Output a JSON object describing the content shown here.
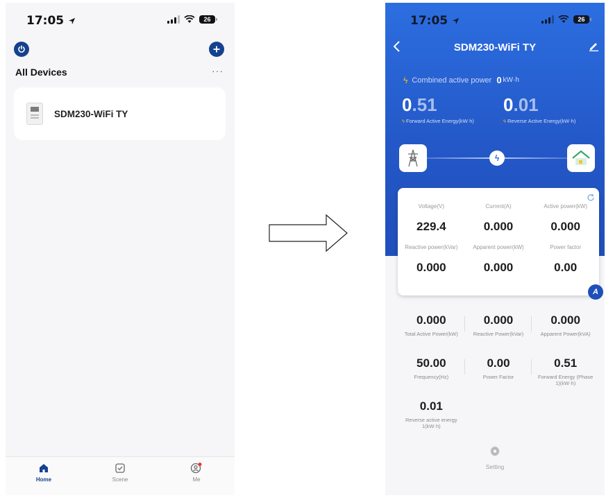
{
  "left_screen": {
    "status": {
      "time": "17:05",
      "battery": "26"
    },
    "section_title": "All Devices",
    "more_label": "···",
    "devices": [
      {
        "name": "SDM230-WiFi TY"
      }
    ],
    "tabs": [
      {
        "label": "Home",
        "icon": "home-icon",
        "active": true
      },
      {
        "label": "Scene",
        "icon": "scene-icon",
        "active": false
      },
      {
        "label": "Me",
        "icon": "profile-icon",
        "active": false
      }
    ],
    "colors": {
      "accent": "#15428e",
      "background": "#f6f6f8",
      "notification": "#e53935"
    }
  },
  "right_screen": {
    "status": {
      "time": "17:05",
      "battery": "26"
    },
    "title": "SDM230-WiFi TY",
    "combined": {
      "label": "Combined active power",
      "value": "0",
      "unit": "kW·h"
    },
    "forward": {
      "int": "0",
      "dec": ".51",
      "label": "Forward Active Energy(kW·h)"
    },
    "reverse": {
      "int": "0",
      "dec": ".01",
      "label": "Reverse Active Energy(kW·h)"
    },
    "live": [
      {
        "label": "Voltage(V)",
        "value": "229.4"
      },
      {
        "label": "Current(A)",
        "value": "0.000"
      },
      {
        "label": "Active power(kW)",
        "value": "0.000"
      },
      {
        "label": "Reactive power(kVar)",
        "value": "0.000"
      },
      {
        "label": "Apparent power(kW)",
        "value": "0.000"
      },
      {
        "label": "Power factor",
        "value": "0.00"
      }
    ],
    "mode_badge": "A",
    "stats": [
      {
        "value": "0.000",
        "label": "Total Active Power(kW)"
      },
      {
        "value": "0.000",
        "label": "Reactive Power(kVar)"
      },
      {
        "value": "0.000",
        "label": "Apparent Power(kVA)"
      },
      {
        "value": "50.00",
        "label": "Frequency(Hz)"
      },
      {
        "value": "0.00",
        "label": "Power Factor"
      },
      {
        "value": "0.51",
        "label": "Forward Energy (Phase 1)(kW·h)"
      },
      {
        "value": "0.01",
        "label": "Reverse active energy 1(kW·h)"
      }
    ],
    "setting_label": "Setting",
    "colors": {
      "header_blue": "#2c6ee0",
      "bolt": "#f8c400"
    }
  }
}
